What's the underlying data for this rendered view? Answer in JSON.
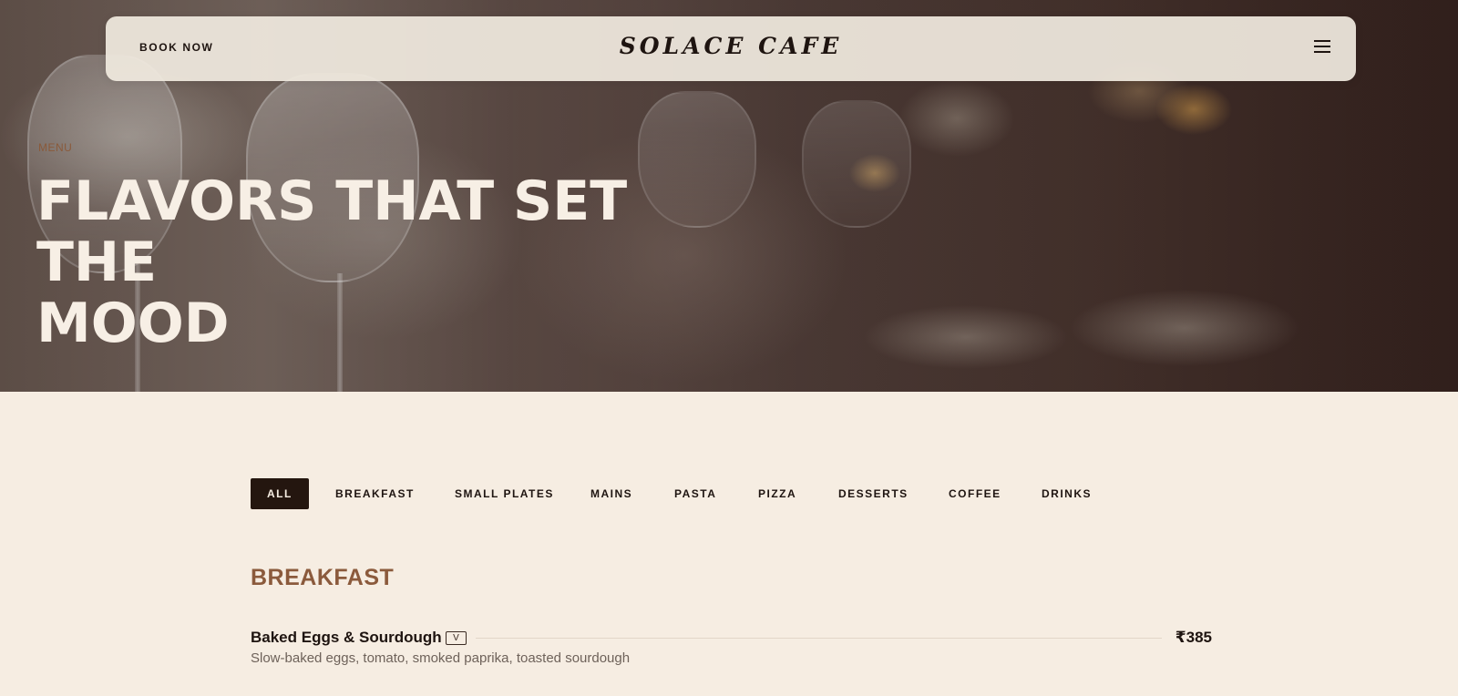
{
  "header": {
    "book_label": "BOOK NOW",
    "logo": "SOLACE CAFE",
    "menu_icon": "hamburger-icon"
  },
  "hero": {
    "eyebrow": "MENU",
    "title_line1": "FLAVORS THAT SET THE",
    "title_line2": "MOOD"
  },
  "tabs": {
    "active": "ALL",
    "items": [
      "ALL",
      "BREAKFAST",
      "SMALL PLATES",
      "MAINS",
      "PASTA",
      "PIZZA",
      "DESSERTS",
      "COFFEE",
      "DRINKS"
    ]
  },
  "section": {
    "title": "BREAKFAST",
    "items": [
      {
        "name": "Baked Eggs & Sourdough",
        "badge": "V",
        "price": "₹385",
        "description": "Slow-baked eggs, tomato, smoked paprika, toasted sourdough"
      }
    ]
  },
  "colors": {
    "background": "#f6ede2",
    "accent": "#8b5a3c",
    "dark": "#24160f",
    "hero_text": "#f7efe5"
  }
}
